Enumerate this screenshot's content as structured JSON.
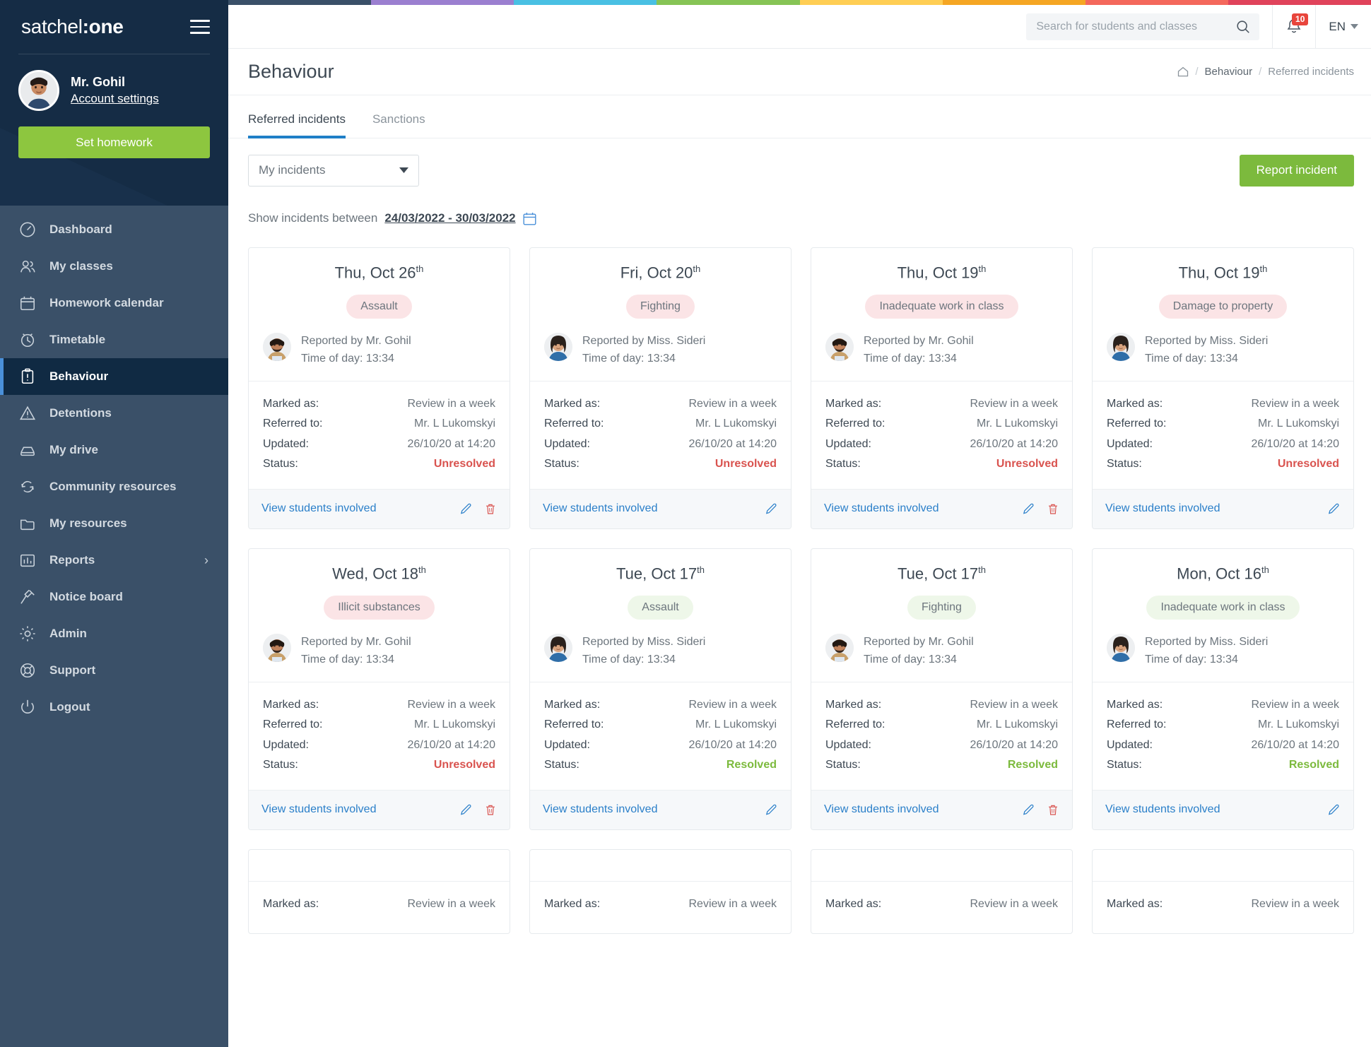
{
  "brand": {
    "light": "satchel",
    "bold": ":one"
  },
  "user": {
    "name": "Mr. Gohil",
    "account_link": "Account settings",
    "homework_button": "Set homework"
  },
  "sidebar": {
    "items": [
      {
        "label": "Dashboard",
        "icon": "gauge-icon",
        "active": false,
        "chevron": ""
      },
      {
        "label": "My classes",
        "icon": "people-icon",
        "active": false,
        "chevron": ""
      },
      {
        "label": "Homework calendar",
        "icon": "calendar-icon",
        "active": false,
        "chevron": ""
      },
      {
        "label": "Timetable",
        "icon": "clock-icon",
        "active": false,
        "chevron": ""
      },
      {
        "label": "Behaviour",
        "icon": "clipboard-icon",
        "active": true,
        "chevron": ""
      },
      {
        "label": "Detentions",
        "icon": "warning-icon",
        "active": false,
        "chevron": ""
      },
      {
        "label": "My drive",
        "icon": "drive-icon",
        "active": false,
        "chevron": ""
      },
      {
        "label": "Community resources",
        "icon": "refresh-icon",
        "active": false,
        "chevron": ""
      },
      {
        "label": "My resources",
        "icon": "folder-icon",
        "active": false,
        "chevron": ""
      },
      {
        "label": "Reports",
        "icon": "bar-chart-icon",
        "active": false,
        "chevron": "›"
      },
      {
        "label": "Notice board",
        "icon": "pin-icon",
        "active": false,
        "chevron": ""
      },
      {
        "label": "Admin",
        "icon": "gear-icon",
        "active": false,
        "chevron": ""
      },
      {
        "label": "Support",
        "icon": "lifebuoy-icon",
        "active": false,
        "chevron": ""
      },
      {
        "label": "Logout",
        "icon": "power-icon",
        "active": false,
        "chevron": ""
      }
    ]
  },
  "topbar": {
    "search_placeholder": "Search for students and classes",
    "search_value": "",
    "notification_count": "10",
    "language": "EN"
  },
  "page": {
    "title": "Behaviour",
    "breadcrumb": {
      "home_icon": "home-icon",
      "sep": "/",
      "items": [
        "Behaviour",
        "Referred incidents"
      ]
    }
  },
  "tabs": [
    {
      "label": "Referred incidents",
      "active": true
    },
    {
      "label": "Sanctions",
      "active": false
    }
  ],
  "filters": {
    "scope_select_value": "My incidents",
    "report_button": "Report incident",
    "date_label": "Show incidents between",
    "date_value": "24/03/2022 - 30/03/2022",
    "date_icon": "calendar-icon"
  },
  "card_labels": {
    "marked_as": "Marked as:",
    "referred_to": "Referred to:",
    "updated": "Updated:",
    "status": "Status:",
    "view_students": "View students involved",
    "edit_icon": "pencil-icon",
    "delete_icon": "trash-icon"
  },
  "colors": {
    "accent_blue": "#1f7fc7",
    "green": "#7cba3d",
    "red": "#d9534f",
    "sidebar": "#3a5068",
    "sidebar_dark": "#152c45",
    "pill_red": "#fbe4e6",
    "pill_green": "#eef7e9",
    "rainbow": [
      "#3a5068",
      "#9b7fd0",
      "#49c0e3",
      "#86c455",
      "#ffce54",
      "#f5a623",
      "#f4685c",
      "#e0435b"
    ]
  },
  "cards": [
    {
      "date": "Thu, Oct 26",
      "ord": "th",
      "type": "Assault",
      "pill": "red",
      "reported_by": "Reported by Mr. Gohil",
      "time": "Time of day: 13:34",
      "avatar": "male",
      "marked_as": "Review in a week",
      "referred_to": "Mr. L Lukomskyi",
      "updated": "26/10/20 at 14:20",
      "status": "Unresolved",
      "status_kind": "unresolved",
      "has_delete": true
    },
    {
      "date": "Fri, Oct 20",
      "ord": "th",
      "type": "Fighting",
      "pill": "red",
      "reported_by": "Reported by Miss. Sideri",
      "time": "Time of day: 13:34",
      "avatar": "female",
      "marked_as": "Review in a week",
      "referred_to": "Mr. L Lukomskyi",
      "updated": "26/10/20 at 14:20",
      "status": "Unresolved",
      "status_kind": "unresolved",
      "has_delete": false
    },
    {
      "date": "Thu, Oct 19",
      "ord": "th",
      "type": "Inadequate work in class",
      "pill": "red",
      "reported_by": "Reported by Mr. Gohil",
      "time": "Time of day: 13:34",
      "avatar": "male",
      "marked_as": "Review in a week",
      "referred_to": "Mr. L Lukomskyi",
      "updated": "26/10/20 at 14:20",
      "status": "Unresolved",
      "status_kind": "unresolved",
      "has_delete": true
    },
    {
      "date": "Thu, Oct 19",
      "ord": "th",
      "type": "Damage to property",
      "pill": "red",
      "reported_by": "Reported by Miss. Sideri",
      "time": "Time of day: 13:34",
      "avatar": "female",
      "marked_as": "Review in a week",
      "referred_to": "Mr. L Lukomskyi",
      "updated": "26/10/20 at 14:20",
      "status": "Unresolved",
      "status_kind": "unresolved",
      "has_delete": false
    },
    {
      "date": "Wed, Oct 18",
      "ord": "th",
      "type": "Illicit substances",
      "pill": "red",
      "reported_by": "Reported by Mr. Gohil",
      "time": "Time of day: 13:34",
      "avatar": "male",
      "marked_as": "Review in a week",
      "referred_to": "Mr. L Lukomskyi",
      "updated": "26/10/20 at 14:20",
      "status": "Unresolved",
      "status_kind": "unresolved",
      "has_delete": true
    },
    {
      "date": "Tue, Oct 17",
      "ord": "th",
      "type": "Assault",
      "pill": "green",
      "reported_by": "Reported by Miss. Sideri",
      "time": "Time of day: 13:34",
      "avatar": "female",
      "marked_as": "Review in a week",
      "referred_to": "Mr. L Lukomskyi",
      "updated": "26/10/20 at 14:20",
      "status": "Resolved",
      "status_kind": "resolved",
      "has_delete": false
    },
    {
      "date": "Tue, Oct 17",
      "ord": "th",
      "type": "Fighting",
      "pill": "green",
      "reported_by": "Reported by Mr. Gohil",
      "time": "Time of day: 13:34",
      "avatar": "male",
      "marked_as": "Review in a week",
      "referred_to": "Mr. L Lukomskyi",
      "updated": "26/10/20 at 14:20",
      "status": "Resolved",
      "status_kind": "resolved",
      "has_delete": true
    },
    {
      "date": "Mon, Oct 16",
      "ord": "th",
      "type": "Inadequate work in class",
      "pill": "green",
      "reported_by": "Reported by Miss. Sideri",
      "time": "Time of day: 13:34",
      "avatar": "female",
      "marked_as": "Review in a week",
      "referred_to": "Mr. L Lukomskyi",
      "updated": "26/10/20 at 14:20",
      "status": "Resolved",
      "status_kind": "resolved",
      "has_delete": false
    }
  ],
  "partial_row": [
    {
      "marked_as_label": "Marked as:",
      "marked_as": "Review in a week"
    },
    {
      "marked_as_label": "Marked as:",
      "marked_as": "Review in a week"
    },
    {
      "marked_as_label": "Marked as:",
      "marked_as": "Review in a week"
    },
    {
      "marked_as_label": "Marked as:",
      "marked_as": "Review in a week"
    }
  ]
}
